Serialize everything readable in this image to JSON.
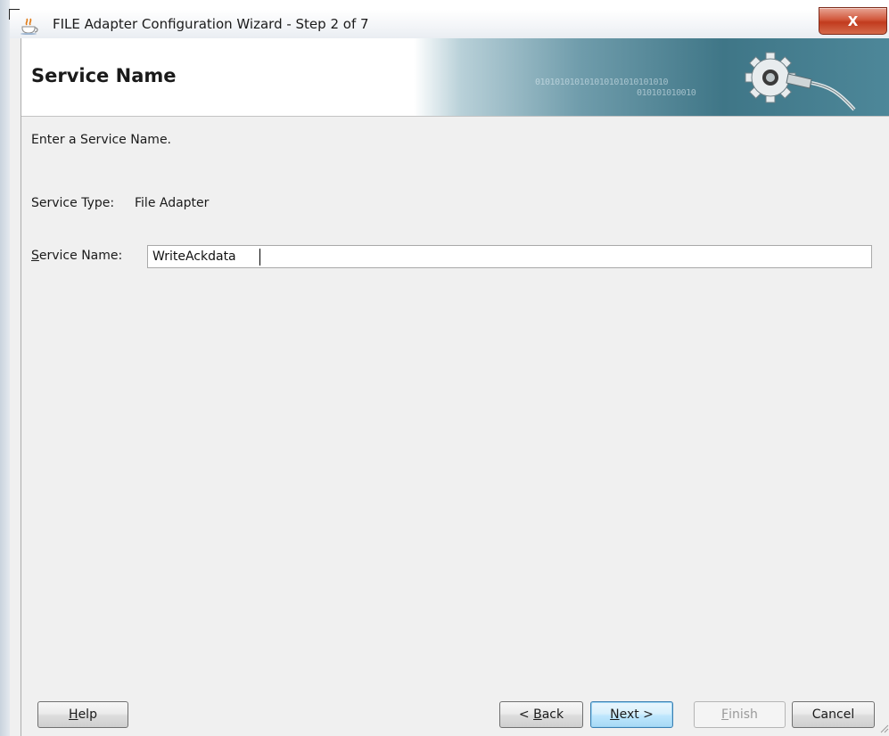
{
  "window": {
    "title": "FILE Adapter Configuration Wizard - Step 2 of 7",
    "close_glyph": "X",
    "app_icon": "java-cup-icon"
  },
  "header": {
    "title": "Service Name",
    "banner_binary_1": "010101010101010101010101010",
    "banner_binary_2": "010101010010",
    "banner_icon": "gear-plug-icon"
  },
  "body": {
    "instruction": "Enter a Service Name.",
    "service_type_label": "Service Type:",
    "service_type_value": "File Adapter",
    "service_name_label": "Service Name:",
    "service_name_value": "WriteAckdata"
  },
  "buttons": {
    "help": {
      "mnemonic": "H",
      "rest": "elp"
    },
    "back": {
      "prefix": "< ",
      "mnemonic": "B",
      "rest": "ack"
    },
    "next": {
      "mnemonic": "N",
      "rest": "ext >"
    },
    "finish": {
      "mnemonic": "F",
      "rest": "inish",
      "enabled": false
    },
    "cancel": "Cancel"
  },
  "colors": {
    "banner_dark": "#3f7687",
    "close_button": "#c13b1e",
    "default_button_border": "#3c7fb1"
  }
}
